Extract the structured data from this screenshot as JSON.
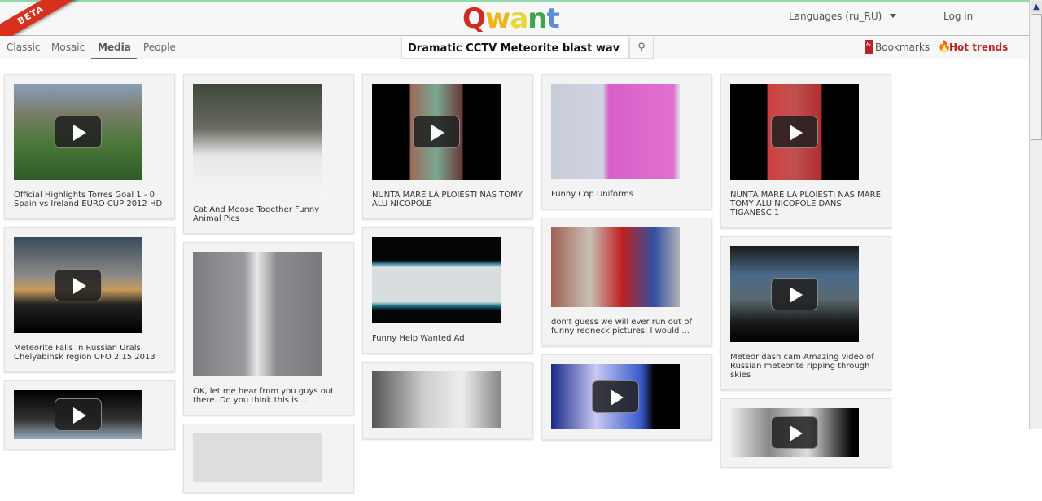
{
  "header": {
    "beta": "BETA",
    "logo": "Qwant",
    "languages": "Languages (ru_RU)",
    "login": "Log in"
  },
  "nav": {
    "tabs": [
      "Classic",
      "Mosaic",
      "Media",
      "People"
    ],
    "active": "Media",
    "search_value": "Dramatic CCTV Meteorite blast wav",
    "bookmarks": "Bookmarks",
    "hot_trends": "Hot trends"
  },
  "columns": [
    [
      {
        "caption": "Official Highlights Torres Goal 1 - 0 Spain vs Ireland EURO CUP 2012 HD",
        "video": true,
        "h": 118,
        "bg": "linear-gradient(#8aa0b8 0%,#7a7c6a 30%,#4d7a3a 60%,#2f5a2a 100%)"
      },
      {
        "caption": "Meteorite Falls In Russian Urals Chelyabinsk region UFO 2 15 2013",
        "video": true,
        "h": 118,
        "bg": "linear-gradient(#3a4a5a 0%,#8a8a88 40%,#c89a5a 55%,#222 70%,#000 100%)"
      },
      {
        "caption": "",
        "video": true,
        "h": 60,
        "bg": "linear-gradient(#000 0%,#333 60%,#9ab 100%)"
      }
    ],
    [
      {
        "caption": "Cat And Moose Together Funny Animal Pics",
        "video": false,
        "h": 136,
        "bg": "linear-gradient(#3d4a3a 0%,#6a6a60 40%,#e8e8ea 65%,#f4f4f6 100%)"
      },
      {
        "caption": "OK, let me hear from you guys out there. Do you think this is ...",
        "video": false,
        "h": 153,
        "bg": "linear-gradient(90deg,#7c7c80 0%,#9a9a9e 40%,#e8e8e8 50%,#8c8c90 65%,#7a7a7e 100%)"
      },
      {
        "caption": "",
        "video": false,
        "h": 60,
        "bg": "#ddd"
      }
    ],
    [
      {
        "caption": "NUNTA MARE LA PLOIESTI NAS TOMY ALU NICOPOLE",
        "video": true,
        "h": 118,
        "bg": "linear-gradient(90deg,#000 0%,#000 29%,#9a6a5a 30%,#7aa890 50%,#6a3a3a 70%,#000 71%,#000 100%)"
      },
      {
        "caption": "Funny Help Wanted Ad",
        "video": false,
        "h": 106,
        "bg": "linear-gradient(#050505 0%,#050505 28%,#1e6f87 30%,#d8dde0 35%,#d8dde0 75%,#1e6f87 80%,#050505 85%)"
      },
      {
        "caption": "",
        "video": false,
        "h": 70,
        "bg": "linear-gradient(90deg,#555 0%,#ccc 40%,#eee 70%,#888 100%)"
      }
    ],
    [
      {
        "caption": "Funny Cop Uniforms",
        "video": false,
        "h": 117,
        "bg": "linear-gradient(90deg,#c8ccd8 0%,#d0d4e0 40%,#d860c8 45%,#e070d0 95%,#d8dce8 100%)"
      },
      {
        "caption": "don't guess we will ever run out of funny redneck pictures. I would ...",
        "video": false,
        "h": 98,
        "bg": "linear-gradient(90deg,#a06050 0%,#c8c0b8 30%,#c02020 55%,#3050a0 80%,#b0b0b8 100%)"
      },
      {
        "caption": "",
        "video": true,
        "h": 80,
        "bg": "linear-gradient(90deg,#1a2a8a 0%,#c8c8f0 35%,#3a5acc 70%,#000 80%)"
      }
    ],
    [
      {
        "caption": "NUNTA MARE LA PLOIESTI NAS MARE TOMY ALU NICOPOLE DANS TIGANESC 1",
        "video": true,
        "h": 118,
        "bg": "linear-gradient(90deg,#000 0%,#000 28%,#d04040 30%,#c05050 50%,#b03030 70%,#000 72%)"
      },
      {
        "caption": "Meteor dash cam Amazing video of Russian meteorite ripping through skies",
        "video": true,
        "h": 118,
        "bg": "linear-gradient(#1a1a1a 0%,#4a6a8a 30%,#5a6a70 55%,#181818 80%,#000 100%)"
      },
      {
        "caption": "",
        "video": true,
        "h": 60,
        "bg": "linear-gradient(90deg,#eee 0%,#888 30%,#ddd 60%,#000 95%)"
      }
    ]
  ]
}
